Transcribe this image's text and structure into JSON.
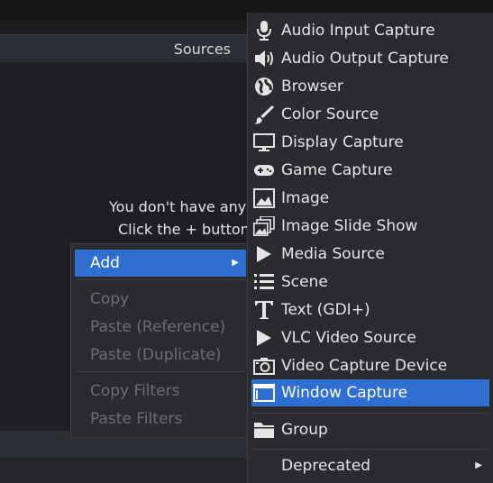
{
  "panel": {
    "title": "Sources",
    "empty_line1": "You don't have any",
    "empty_line2": "Click the + button"
  },
  "context_menu": {
    "items": [
      {
        "label": "Add",
        "enabled": true,
        "active": true,
        "has_submenu": true
      },
      {
        "label": "Copy",
        "enabled": false
      },
      {
        "label": "Paste (Reference)",
        "enabled": false
      },
      {
        "label": "Paste (Duplicate)",
        "enabled": false
      },
      {
        "label": "Copy Filters",
        "enabled": false
      },
      {
        "label": "Paste Filters",
        "enabled": false
      }
    ]
  },
  "add_submenu": {
    "items": [
      {
        "label": "Audio Input Capture",
        "icon": "microphone-icon"
      },
      {
        "label": "Audio Output Capture",
        "icon": "speaker-icon"
      },
      {
        "label": "Browser",
        "icon": "globe-icon"
      },
      {
        "label": "Color Source",
        "icon": "paintbrush-icon"
      },
      {
        "label": "Display Capture",
        "icon": "monitor-icon"
      },
      {
        "label": "Game Capture",
        "icon": "gamepad-icon"
      },
      {
        "label": "Image",
        "icon": "image-icon"
      },
      {
        "label": "Image Slide Show",
        "icon": "slideshow-icon"
      },
      {
        "label": "Media Source",
        "icon": "play-icon"
      },
      {
        "label": "Scene",
        "icon": "list-icon"
      },
      {
        "label": "Text (GDI+)",
        "icon": "text-icon"
      },
      {
        "label": "VLC Video Source",
        "icon": "play-icon"
      },
      {
        "label": "Video Capture Device",
        "icon": "camera-icon"
      },
      {
        "label": "Window Capture",
        "icon": "window-icon",
        "active": true
      },
      {
        "label": "Group",
        "icon": "folder-icon"
      },
      {
        "label": "Deprecated",
        "has_submenu": true
      }
    ]
  },
  "colors": {
    "highlight": "#2f6fd1",
    "menu_bg": "#2a2b2f",
    "panel_bg": "#1e1f22"
  }
}
